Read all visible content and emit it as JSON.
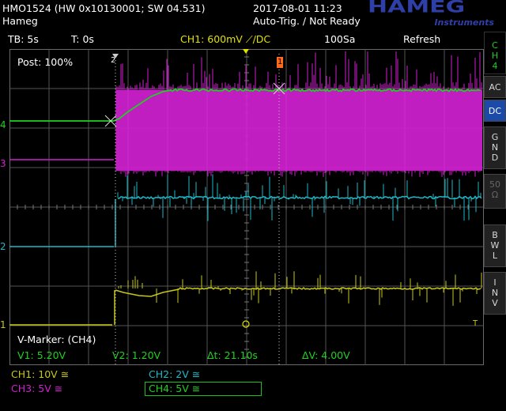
{
  "header": {
    "device": "HMO1524 (HW 0x10130001; SW 04.531)",
    "name": "Hameg",
    "datetime": "2017-08-01 11:23",
    "trigger_state": "Auto-Trig. / Not Ready",
    "logo": "HAMEG",
    "logo_sub": "Instruments"
  },
  "status": {
    "timebase": "TB: 5s",
    "time_offset": "T: 0s",
    "trigger_ch": "CH1: 600mV ⟋/DC",
    "samples": "100Sa",
    "mode": "Refresh"
  },
  "sidebar": {
    "channel": [
      "C",
      "H",
      "4"
    ],
    "ac": "AC",
    "dc": "DC",
    "gnd": [
      "G",
      "N",
      "D"
    ],
    "ohm": [
      "50",
      "Ω"
    ],
    "bwl": [
      "B",
      "W",
      "L"
    ],
    "inv": [
      "I",
      "N",
      "V"
    ]
  },
  "scope": {
    "post": "Post: 100%",
    "marker_2": "2",
    "marker_1": "1",
    "ch_markers": [
      "4",
      "3",
      "2",
      "1"
    ],
    "trigger_marker": "T",
    "vmarker_title": "V-Marker: (CH4)",
    "v1": "V1: 5.20V",
    "v2": "V2: 1.20V",
    "dt": "Δt: 21.10s",
    "dv": "ΔV: 4.00V"
  },
  "channels": {
    "ch1": "CH1: 10V ≅",
    "ch2": "CH2: 2V ≅",
    "ch3": "CH3: 5V ≅",
    "ch4": "CH4: 5V ≅"
  },
  "colors": {
    "ch1": "#c8c818",
    "ch2": "#20b8c8",
    "ch3": "#d020d0",
    "ch4": "#20d020",
    "ui_yellow": "#e0e000",
    "marker_orange": "#ff6a1a",
    "active_button": "#1c4aa8"
  }
}
